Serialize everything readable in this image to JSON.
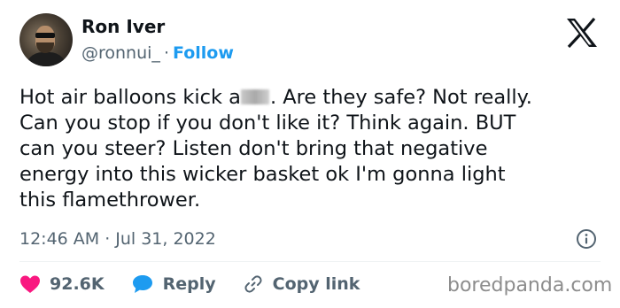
{
  "author": {
    "name": "Ron Iver",
    "handle": "@ronnui_",
    "separator": "·",
    "follow_label": "Follow"
  },
  "tweet": {
    "text_before_redaction": "Hot air balloons kick a",
    "text_after_redaction": ". Are they safe? Not really.\nCan you stop if you don't like it? Think again. BUT\ncan you steer? Listen don't bring that negative\nenergy into this wicker basket ok I'm gonna light\nthis flamethrower.",
    "time": "12:46 AM",
    "separator": "·",
    "date": "Jul 31, 2022"
  },
  "actions": {
    "likes": "92.6K",
    "reply_label": "Reply",
    "copy_link_label": "Copy link"
  },
  "watermark": "boredpanda.com",
  "colors": {
    "link_blue": "#1d9bf0",
    "like_red": "#f91880",
    "text_gray": "#536471"
  },
  "icons": [
    "x-logo-icon",
    "info-icon",
    "heart-icon",
    "reply-bubble-icon",
    "link-icon"
  ]
}
